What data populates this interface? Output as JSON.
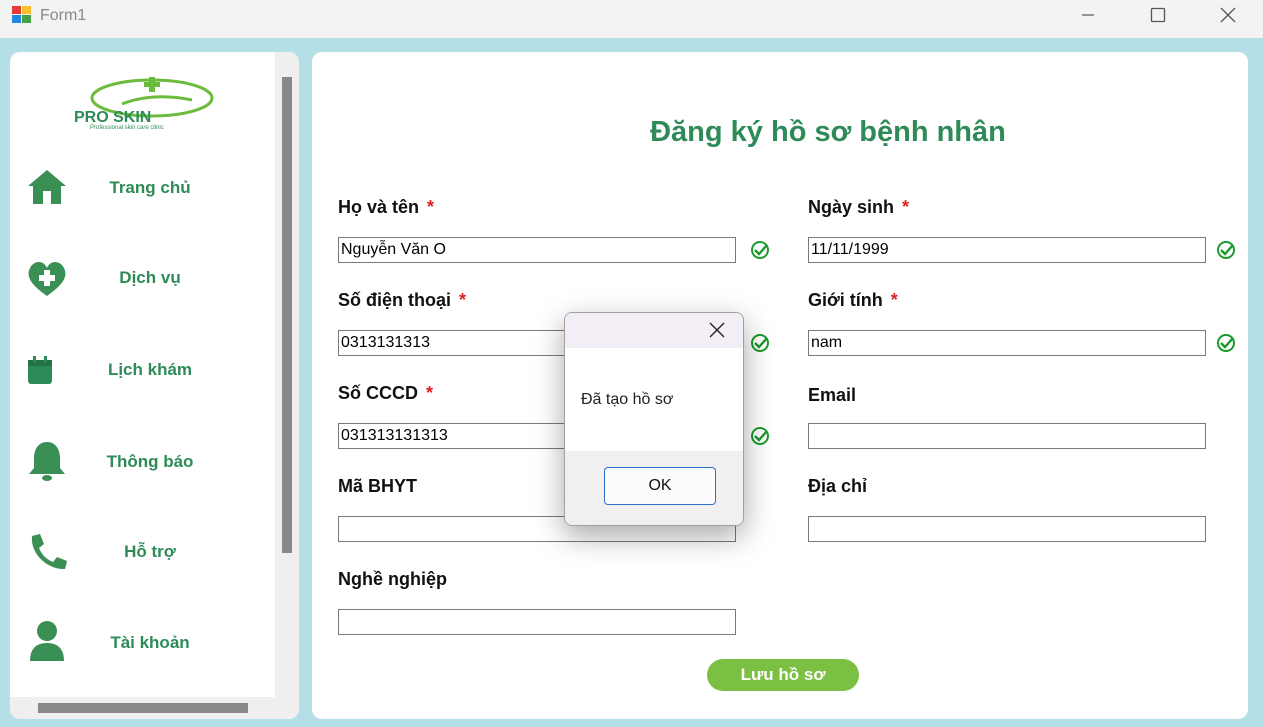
{
  "window": {
    "title": "Form1"
  },
  "sidebar": {
    "logo": {
      "text": "PRO SKIN",
      "tagline": "Professional skin care clinic"
    },
    "items": [
      {
        "label": "Trang chủ",
        "icon": "home-icon"
      },
      {
        "label": "Dịch vụ",
        "icon": "heart-plus-icon"
      },
      {
        "label": "Lịch khám",
        "icon": "calendar-icon"
      },
      {
        "label": "Thông báo",
        "icon": "bell-icon"
      },
      {
        "label": "Hỗ trợ",
        "icon": "phone-icon"
      },
      {
        "label": "Tài khoản",
        "icon": "user-icon"
      }
    ]
  },
  "form": {
    "title": "Đăng ký hồ sơ bệnh nhân",
    "required_mark": "*",
    "fields": {
      "full_name": {
        "label": "Họ và tên",
        "value": "Nguyễn Văn O"
      },
      "birth_date": {
        "label": "Ngày sinh",
        "value": "11/11/1999"
      },
      "phone": {
        "label": "Số điện thoại",
        "value": "0313131313"
      },
      "gender": {
        "label": "Giới tính",
        "value": "nam"
      },
      "cccd": {
        "label": "Số CCCD",
        "value": "031313131313"
      },
      "email": {
        "label": "Email",
        "value": ""
      },
      "bhyt": {
        "label": "Mã BHYT",
        "value": ""
      },
      "address": {
        "label": "Địa chỉ",
        "value": ""
      },
      "occupation": {
        "label": "Nghề nghiệp",
        "value": ""
      }
    },
    "save_label": "Lưu hồ sơ"
  },
  "dialog": {
    "message": "Đã tạo hồ sơ",
    "ok_label": "OK"
  },
  "colors": {
    "accent": "#2e8b57",
    "button": "#7cc043",
    "background": "#b4dfe6",
    "valid": "#1a9a2a"
  }
}
